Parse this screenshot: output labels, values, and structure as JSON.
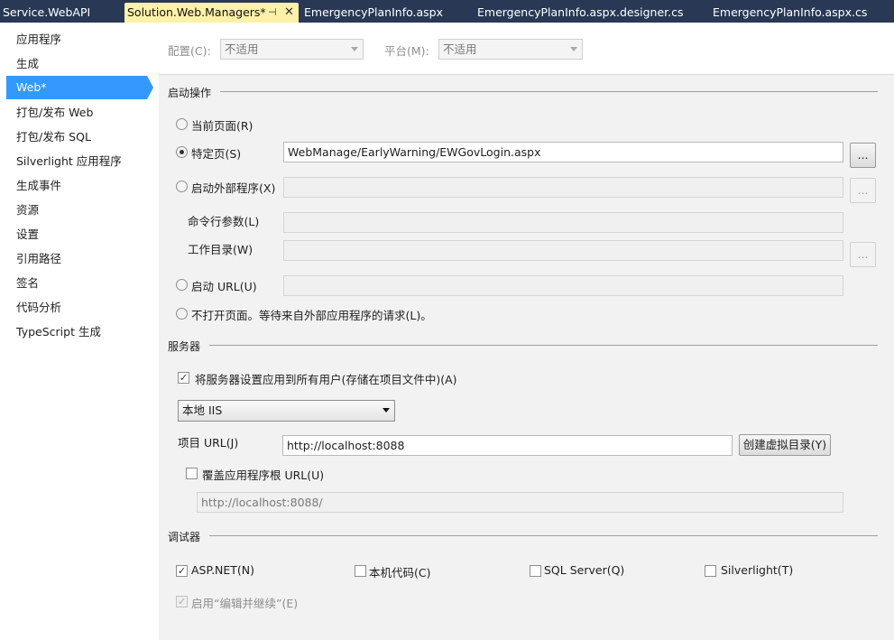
{
  "tabs": [
    {
      "label": "Service.WebAPI",
      "active": false
    },
    {
      "label": "Solution.Web.Managers*",
      "active": true
    },
    {
      "label": "EmergencyPlanInfo.aspx",
      "active": false
    },
    {
      "label": "EmergencyPlanInfo.aspx.designer.cs",
      "active": false
    },
    {
      "label": "EmergencyPlanInfo.aspx.cs",
      "active": false
    }
  ],
  "tab_icons": {
    "pin": "pin-icon",
    "close": "close-icon"
  },
  "sidebar": {
    "items": [
      {
        "label": "应用程序"
      },
      {
        "label": "生成"
      },
      {
        "label": "Web*",
        "selected": true
      },
      {
        "label": "打包/发布 Web"
      },
      {
        "label": "打包/发布 SQL"
      },
      {
        "label": "Silverlight 应用程序"
      },
      {
        "label": "生成事件"
      },
      {
        "label": "资源"
      },
      {
        "label": "设置"
      },
      {
        "label": "引用路径"
      },
      {
        "label": "签名"
      },
      {
        "label": "代码分析"
      },
      {
        "label": "TypeScript 生成"
      }
    ]
  },
  "config": {
    "label": "配置(C):",
    "value": "不适用"
  },
  "platform": {
    "label": "平台(M):",
    "value": "不适用"
  },
  "start_action": {
    "title": "启动操作",
    "current_page": "当前页面(R)",
    "specific_page": "特定页(S)",
    "specific_page_value": "WebManage/EarlyWarning/EWGovLogin.aspx",
    "external_program": "启动外部程序(X)",
    "cmd_args": "命令行参数(L)",
    "working_dir": "工作目录(W)",
    "start_url": "启动 URL(U)",
    "dont_open": "不打开页面。等待来自外部应用程序的请求(L)。",
    "browse_label": "..."
  },
  "servers": {
    "title": "服务器",
    "apply_all": "将服务器设置应用到所有用户(存储在项目文件中)(A)",
    "server_type": "本地 IIS",
    "project_url_label": "项目 URL(J)",
    "project_url": "http://localhost:8088",
    "create_vdir": "创建虚拟目录(Y)",
    "override_root": "覆盖应用程序根 URL(U)",
    "override_root_value": "http://localhost:8088/"
  },
  "debuggers": {
    "title": "调试器",
    "aspnet": "ASP.NET(N)",
    "native": "本机代码(C)",
    "sql": "SQL Server(Q)",
    "silverlight": "Silverlight(T)",
    "edit_continue": "启用“编辑并继续”(E)"
  },
  "checkmark": "✓",
  "colors": {
    "tab_strip": "#293955",
    "active_tab": "#fff1a7",
    "selection": "#3399ff",
    "panel": "#f2f2f2"
  }
}
